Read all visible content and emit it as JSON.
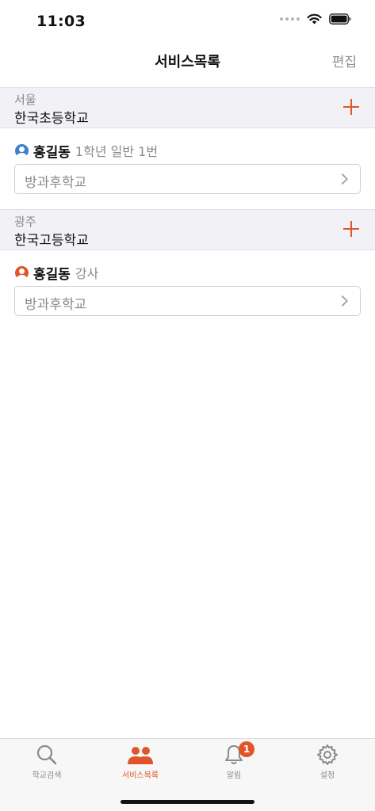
{
  "status": {
    "time": "11:03"
  },
  "nav": {
    "title": "서비스목록",
    "edit_label": "편집"
  },
  "sections": [
    {
      "region": "서울",
      "school": "한국초등학교",
      "member": {
        "name": "홍길동",
        "role": "1학년 일반 1번",
        "avatar_color": "#3d7fd0"
      },
      "service": "방과후학교"
    },
    {
      "region": "광주",
      "school": "한국고등학교",
      "member": {
        "name": "홍길동",
        "role": "강사",
        "avatar_color": "#e0552a"
      },
      "service": "방과후학교"
    }
  ],
  "tabs": [
    {
      "label": "학교검색",
      "icon": "search-icon",
      "active": false
    },
    {
      "label": "서비스목록",
      "icon": "people-icon",
      "active": true
    },
    {
      "label": "알림",
      "icon": "bell-icon",
      "active": false,
      "badge": "1"
    },
    {
      "label": "설정",
      "icon": "gear-icon",
      "active": false
    }
  ],
  "colors": {
    "accent": "#e0552a",
    "inactive": "#8a8a8e",
    "section_bg": "#f2f2f6"
  }
}
